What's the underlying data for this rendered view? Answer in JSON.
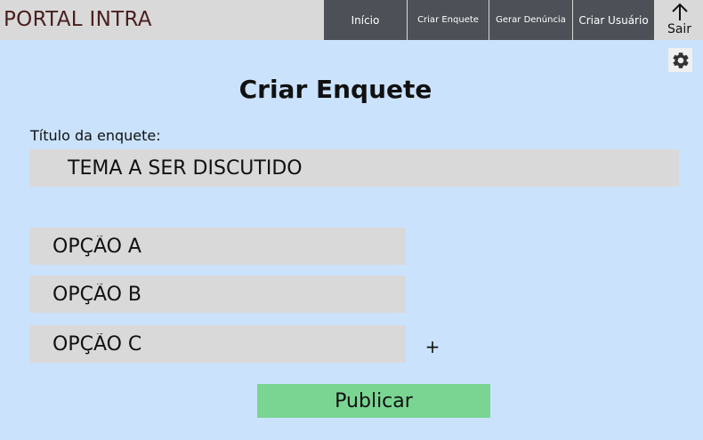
{
  "app": {
    "title": "PORTAL INTRA"
  },
  "nav": {
    "inicio": "Início",
    "criar_enquete": "Criar Enquete",
    "gerar_denuncia": "Gerar Denúncia",
    "criar_usuario": "Criar Usuário",
    "sair": "Sair"
  },
  "page": {
    "title": "Criar Enquete"
  },
  "form": {
    "title_label": "Título da enquete:",
    "title_value": "TEMA A SER DISCUTIDO",
    "options": [
      "OPÇÃO A",
      "OPÇÃO B",
      "OPÇÃO C"
    ],
    "add_option": "+",
    "publish_label": "Publicar"
  },
  "icons": {
    "logout": "arrow-up-icon",
    "settings": "gear-icon"
  },
  "colors": {
    "background": "#cae2fc",
    "topbar": "#d9d9d9",
    "nav_button": "#4d5157",
    "brand_text": "#4a1f1f",
    "input": "#d9d9d9",
    "publish_button": "#7ad592"
  }
}
